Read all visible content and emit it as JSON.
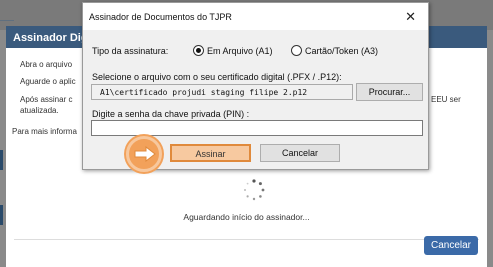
{
  "background_modal": {
    "title": "Assinador Digi",
    "lines": [
      "Abra o arquivo",
      "Aguarde o aplic",
      "Após assinar c",
      "atualizada.",
      "Para mais informa"
    ],
    "right_fragment": "EEU ser",
    "waiting_text": "Aguardando início do assinador...",
    "cancel_label": "Cancelar",
    "accent_color": "#3b6aa8"
  },
  "dialog": {
    "title": "Assinador de Documentos do TJPR",
    "close_icon": "close-icon",
    "signature_type_label": "Tipo da assinatura:",
    "options": [
      {
        "label": "Em Arquivo (A1)",
        "selected": true
      },
      {
        "label": "Cartão/Token (A3)",
        "selected": false
      }
    ],
    "select_file_label": "Selecione o arquivo com o seu certificado digital (.PFX / .P12):",
    "file_path": "A1\\certificado projudi staging filipe 2.p12",
    "browse_label": "Procurar...",
    "pin_label": "Digite a senha da chave privada (PIN) :",
    "pin_value": "",
    "sign_label": "Assinar",
    "cancel_label": "Cancelar",
    "highlight_color": "#f2a15a"
  }
}
